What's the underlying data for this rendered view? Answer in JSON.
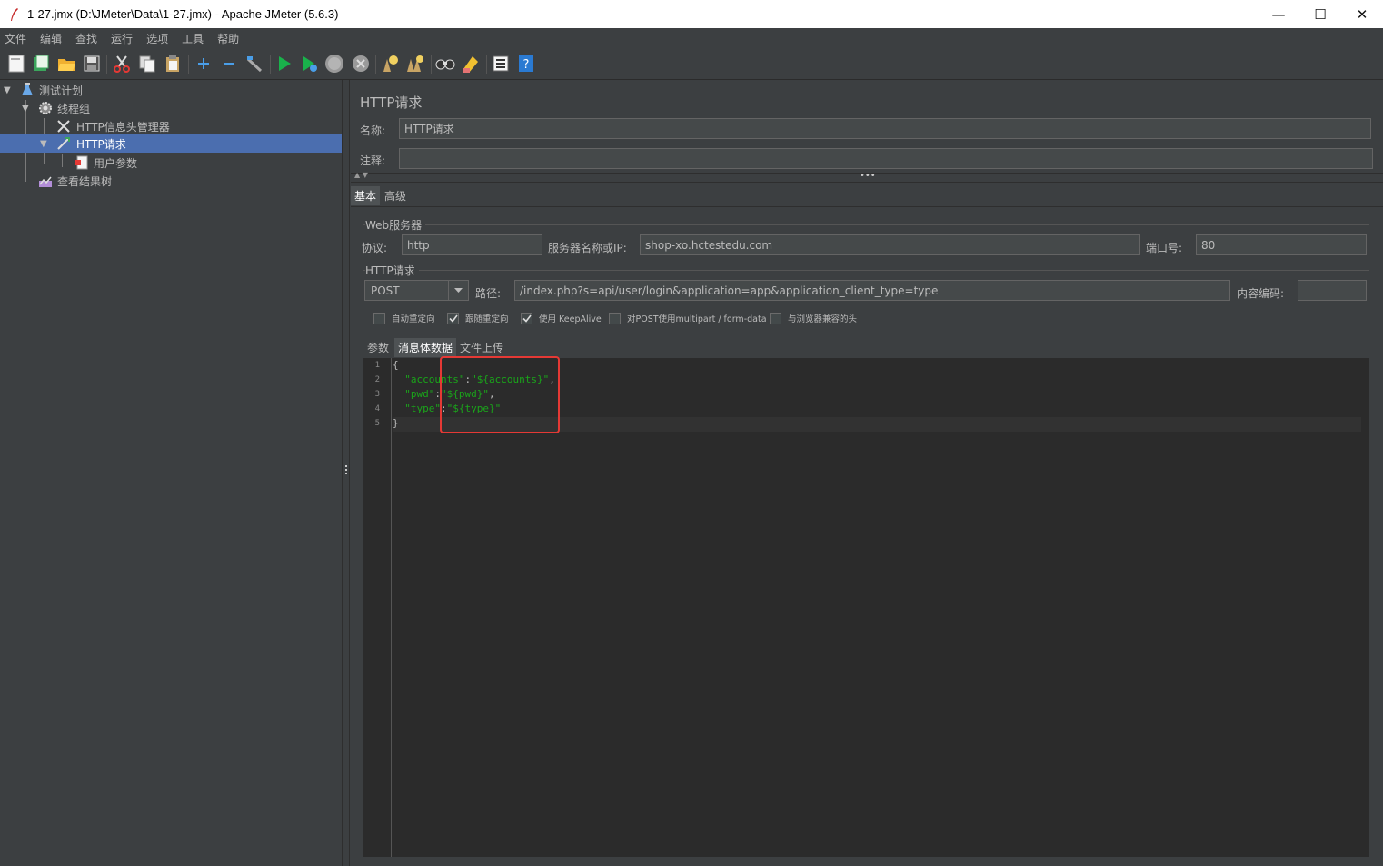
{
  "window": {
    "title": "1-27.jmx (D:\\JMeter\\Data\\1-27.jmx) - Apache JMeter (5.6.3)",
    "minimize": "—",
    "maximize": "☐",
    "close": "✕"
  },
  "menu": [
    "文件",
    "编辑",
    "查找",
    "运行",
    "选项",
    "工具",
    "帮助"
  ],
  "toolbar": {
    "icons": [
      "new-icon",
      "templates-icon",
      "open-icon",
      "save-icon",
      "cut-icon",
      "copy-icon",
      "paste-icon",
      "expand-icon",
      "collapse-icon",
      "toggle-icon",
      "start-icon",
      "start-no-pause-icon",
      "stop-icon",
      "shutdown-icon",
      "clear-icon",
      "clear-all-icon",
      "search-icon",
      "reset-search-icon",
      "function-helper-icon",
      "help-icon"
    ]
  },
  "tree": {
    "items": [
      {
        "label": "测试计划",
        "icon": "test-plan-icon"
      },
      {
        "label": "线程组",
        "icon": "thread-group-icon"
      },
      {
        "label": "HTTP信息头管理器",
        "icon": "header-manager-icon"
      },
      {
        "label": "HTTP请求",
        "icon": "http-request-icon"
      },
      {
        "label": "用户参数",
        "icon": "user-parameters-icon"
      },
      {
        "label": "查看结果树",
        "icon": "results-tree-icon"
      }
    ]
  },
  "panel": {
    "title": "HTTP请求",
    "name_label": "名称:",
    "name_value": "HTTP请求",
    "comment_label": "注释:",
    "comment_value": "",
    "tabs": [
      "基本",
      "高级"
    ],
    "web_server": {
      "title": "Web服务器",
      "protocol_label": "协议:",
      "protocol_value": "http",
      "server_label": "服务器名称或IP:",
      "server_value": "shop-xo.hctestedu.com",
      "port_label": "端口号:",
      "port_value": "80"
    },
    "http_request": {
      "title": "HTTP请求",
      "method": "POST",
      "path_label": "路径:",
      "path_value": "/index.php?s=api/user/login&application=app&application_client_type=type",
      "encoding_label": "内容编码:",
      "encoding_value": ""
    },
    "options": [
      {
        "label": "自动重定向",
        "checked": false
      },
      {
        "label": "跟随重定向",
        "checked": true
      },
      {
        "label": "使用 KeepAlive",
        "checked": true
      },
      {
        "label": "对POST使用multipart / form-data",
        "checked": false
      },
      {
        "label": "与浏览器兼容的头",
        "checked": false
      }
    ],
    "body_tabs": [
      "参数",
      "消息体数据",
      "文件上传"
    ],
    "code": {
      "line_numbers": [
        "1",
        "2",
        "3",
        "4",
        "5"
      ],
      "l1": "{",
      "l2_key": "\"accounts\"",
      "l2_colon": ":",
      "l2_val": "\"${accounts}\"",
      "l2_comma": ",",
      "l3_key": "\"pwd\"",
      "l3_colon": ":",
      "l3_val": "\"${pwd}\"",
      "l3_comma": ",",
      "l4_key": "\"type\"",
      "l4_colon": ":",
      "l4_val": "\"${type}\"",
      "l5": "}"
    },
    "colors": {
      "selection": "#4b6eaf",
      "string": "#1aa51a",
      "highlight": "#e53935"
    }
  }
}
